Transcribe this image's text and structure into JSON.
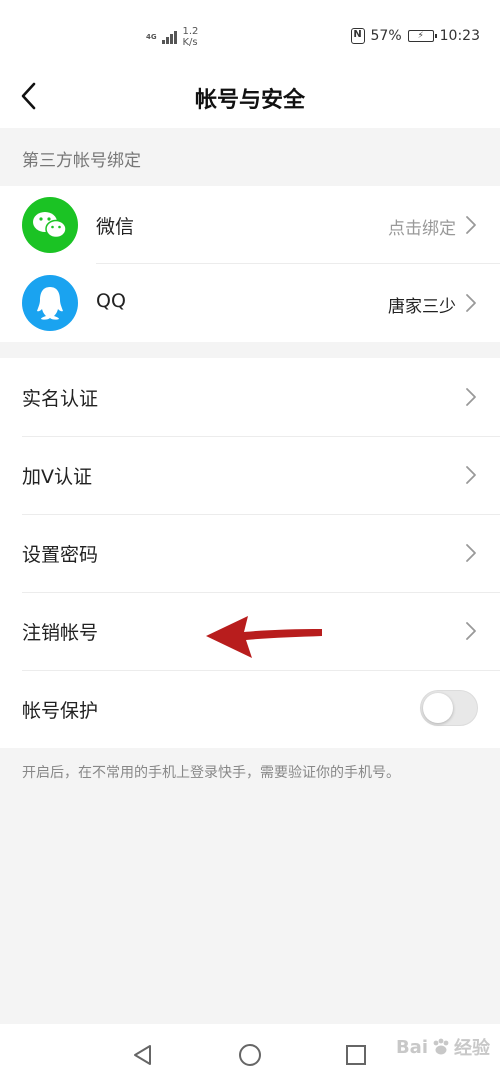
{
  "status_bar": {
    "network": "4G",
    "speed_value": "1.2",
    "speed_unit": "K/s",
    "nfc_icon": "N",
    "battery": "57%",
    "time": "10:23"
  },
  "header": {
    "title": "帐号与安全",
    "back_icon": "chevron-left-icon"
  },
  "third_party": {
    "section_label": "第三方帐号绑定",
    "items": [
      {
        "label": "微信",
        "value": "点击绑定",
        "icon": "wechat-icon",
        "color": "#1bc324"
      },
      {
        "label": "QQ",
        "value": "唐家三少",
        "icon": "qq-icon",
        "color": "#1aa3f0"
      }
    ]
  },
  "settings": {
    "items": [
      {
        "label": "实名认证"
      },
      {
        "label": "加V认证"
      },
      {
        "label": "设置密码"
      },
      {
        "label": "注销帐号"
      }
    ],
    "protection": {
      "label": "帐号保护",
      "enabled": false
    },
    "hint": "开启后，在不常用的手机上登录快手，需要验证你的手机号。"
  },
  "annotation": {
    "icon": "red-arrow-icon",
    "color": "#b81d1d"
  },
  "watermark": {
    "text": "Bai",
    "suffix": "经验"
  },
  "colors": {
    "background": "#f4f4f4",
    "panel": "#ffffff",
    "secondary_text": "#999999"
  }
}
